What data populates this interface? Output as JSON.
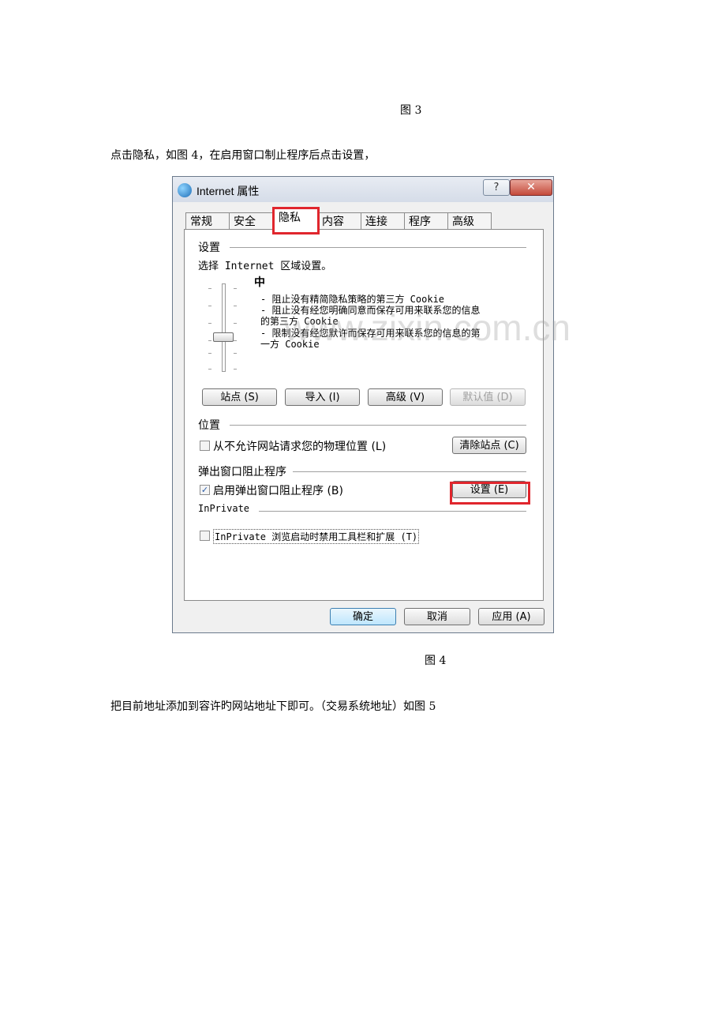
{
  "doc": {
    "caption_3": "图 3",
    "instruction_1": "点击隐私，如图 4，在启用窗口制止程序后点击设置，",
    "caption_4": "图 4",
    "instruction_2": "把目前地址添加到容许旳网站地址下即可。（交易系统地址）如图 5"
  },
  "dialog": {
    "title": "Internet 属性",
    "help_label": "?",
    "close_label": "✕",
    "tabs": [
      "常规",
      "安全",
      "隐私",
      "内容",
      "连接",
      "程序",
      "高级"
    ],
    "active_tab": "隐私",
    "settings_group": "设置",
    "zone_prompt": "选择 Internet 区域设置。",
    "level_name": "中",
    "level_desc_1": "- 阻止没有精简隐私策略的第三方 Cookie",
    "level_desc_2a": "- 阻止没有经您明确同意而保存可用来联系您的信息",
    "level_desc_2b": "的第三方 Cookie",
    "level_desc_3a": "- 限制没有经您默许而保存可用来联系您的信息的第",
    "level_desc_3b": "一方 Cookie",
    "buttons": {
      "sites": "站点 (S)",
      "import": "导入 (I)",
      "advanced": "高级 (V)",
      "default": "默认值 (D)",
      "clear_sites": "清除站点 (C)",
      "popup_settings": "设置 (E)",
      "ok": "确定",
      "cancel": "取消",
      "apply": "应用 (A)"
    },
    "location_group": "位置",
    "location_checkbox": "从不允许网站请求您的物理位置 (L)",
    "location_checked": false,
    "popup_group": "弹出窗口阻止程序",
    "popup_checkbox": "启用弹出窗口阻止程序 (B)",
    "popup_checked": true,
    "inprivate_group": "InPrivate",
    "inprivate_checkbox": "InPrivate 浏览启动时禁用工具栏和扩展 (T)",
    "inprivate_checked": false,
    "check_mark": "✓"
  },
  "watermark": "www.zixin.com.cn",
  "colors": {
    "highlight": "#e0262d",
    "close_button": "#c44a3a"
  }
}
